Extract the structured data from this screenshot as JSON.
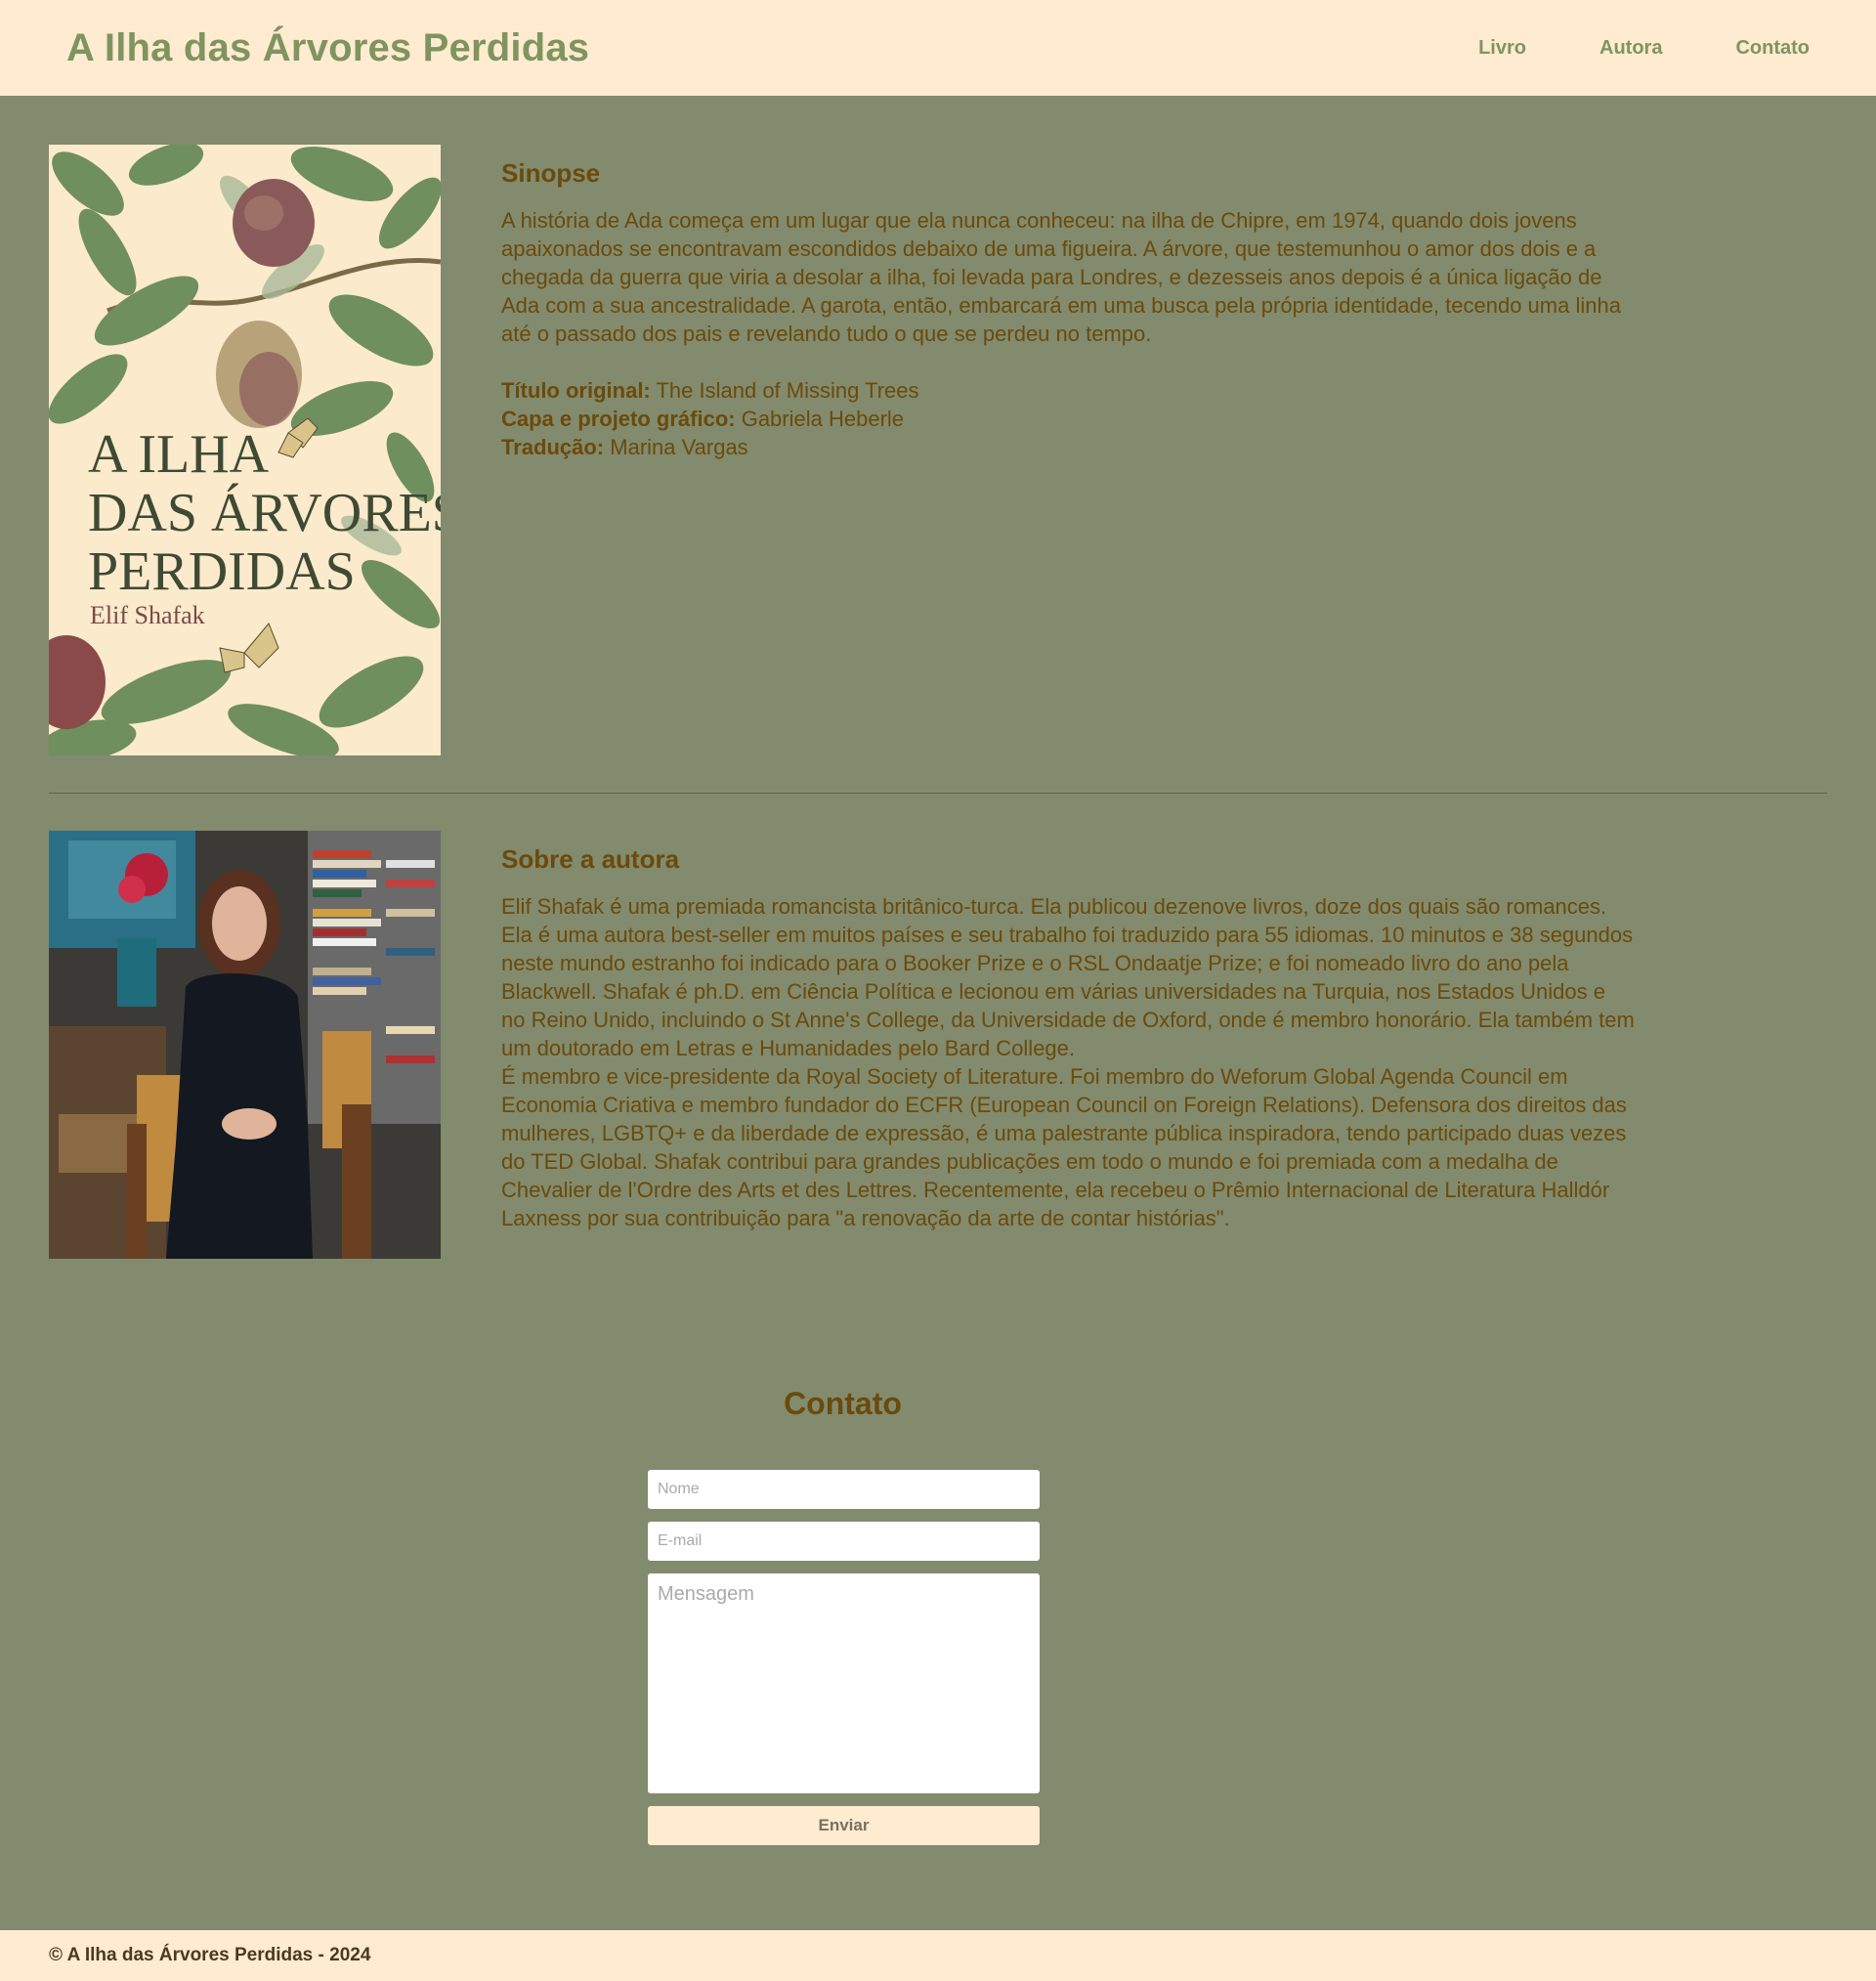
{
  "header": {
    "site_title": "A Ilha das Árvores Perdidas",
    "nav": [
      "Livro",
      "Autora",
      "Contato"
    ]
  },
  "book": {
    "cover_title_lines": [
      "A ILHA",
      "DAS ÁRVORES",
      "PERDIDAS"
    ],
    "cover_author": "Elif Shafak",
    "heading": "Sinopse",
    "synopsis": "A história de Ada começa em um lugar que ela nunca conheceu: na ilha de Chipre, em 1974, quando dois jovens apaixonados se encontravam escondidos debaixo de uma figueira. A árvore, que testemunhou o amor dos dois e a chegada da guerra que viria a desolar a ilha, foi levada para Londres, e dezesseis anos depois é a única ligação de Ada com a sua ancestralidade. A garota, então, embarcará em uma busca pela própria identidade, tecendo uma linha até o passado dos pais e revelando tudo o que se perdeu no tempo.",
    "details": [
      {
        "label": "Título original:",
        "value": " The Island of Missing Trees"
      },
      {
        "label": "Capa e projeto gráfico:",
        "value": " Gabriela Heberle"
      },
      {
        "label": "Tradução:",
        "value": " Marina Vargas"
      }
    ]
  },
  "author": {
    "heading": "Sobre a autora",
    "paragraphs": [
      "Elif Shafak é uma premiada romancista britânico-turca. Ela publicou dezenove livros, doze dos quais são romances. Ela é uma autora best-seller em muitos países e seu trabalho foi traduzido para 55 idiomas. 10 minutos e 38 segundos neste mundo estranho foi indicado para o Booker Prize e o RSL Ondaatje Prize; e foi nomeado livro do ano pela Blackwell. Shafak é ph.D. em Ciência Política e lecionou em várias universidades na Turquia, nos Estados Unidos e no Reino Unido, incluindo o St Anne's College, da Universidade de Oxford, onde é membro honorário. Ela também tem um doutorado em Letras e Humanidades pelo Bard College.",
      "É membro e vice-presidente da Royal Society of Literature. Foi membro do Weforum Global Agenda Council em Economia Criativa e membro fundador do ECFR (European Council on Foreign Relations). Defensora dos direitos das mulheres, LGBTQ+ e da liberdade de expressão, é uma palestrante pública inspiradora, tendo participado duas vezes do TED Global. Shafak contribui para grandes publicações em todo o mundo e foi premiada com a medalha de Chevalier de l'Ordre des Arts et des Lettres. Recentemente, ela recebeu o Prêmio Internacional de Literatura Halldór Laxness por sua contribuição para \"a renovação da arte de contar histórias\"."
    ]
  },
  "contact": {
    "heading": "Contato",
    "name_placeholder": "Nome",
    "email_placeholder": "E-mail",
    "message_placeholder": "Mensagem",
    "submit_label": "Enviar"
  },
  "footer": {
    "text": "© A Ilha das Árvores Perdidas - 2024"
  },
  "colors": {
    "page_bg": "#828b6d",
    "header_bg": "#feebd0",
    "title_green": "#7f9460",
    "text_brown": "#6b4a0c"
  }
}
